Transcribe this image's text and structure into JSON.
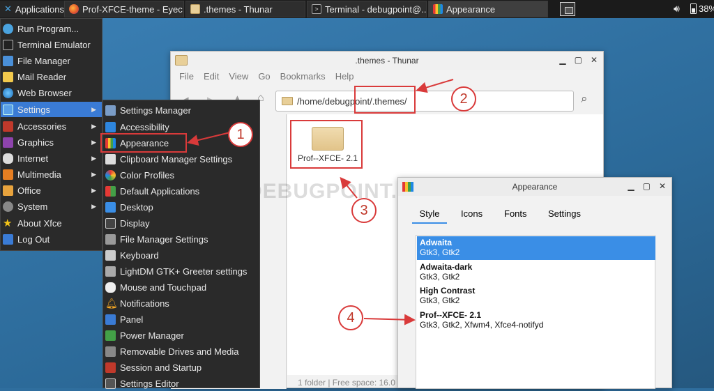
{
  "panel": {
    "applications_label": "Applications",
    "tasks": [
      {
        "label": "Prof-XFCE-theme - Eyec...",
        "icon": "firefox-icon"
      },
      {
        "label": ".themes - Thunar",
        "icon": "folder-icon"
      },
      {
        "label": "Terminal - debugpoint@...",
        "icon": "terminal-icon"
      },
      {
        "label": "Appearance",
        "icon": "appearance-icon"
      }
    ],
    "battery_text": "38%"
  },
  "app_menu": {
    "items": [
      {
        "label": "Run Program..."
      },
      {
        "label": "Terminal Emulator"
      },
      {
        "label": "File Manager"
      },
      {
        "label": "Mail Reader"
      },
      {
        "label": "Web Browser"
      },
      {
        "label": "Settings"
      },
      {
        "label": "Accessories"
      },
      {
        "label": "Graphics"
      },
      {
        "label": "Internet"
      },
      {
        "label": "Multimedia"
      },
      {
        "label": "Office"
      },
      {
        "label": "System"
      },
      {
        "label": "About Xfce"
      },
      {
        "label": "Log Out"
      }
    ]
  },
  "settings_menu": {
    "items": [
      {
        "label": "Settings Manager"
      },
      {
        "label": "Accessibility"
      },
      {
        "label": "Appearance"
      },
      {
        "label": "Clipboard Manager Settings"
      },
      {
        "label": "Color Profiles"
      },
      {
        "label": "Default Applications"
      },
      {
        "label": "Desktop"
      },
      {
        "label": "Display"
      },
      {
        "label": "File Manager Settings"
      },
      {
        "label": "Keyboard"
      },
      {
        "label": "LightDM GTK+ Greeter settings"
      },
      {
        "label": "Mouse and Touchpad"
      },
      {
        "label": "Notifications"
      },
      {
        "label": "Panel"
      },
      {
        "label": "Power Manager"
      },
      {
        "label": "Removable Drives and Media"
      },
      {
        "label": "Session and Startup"
      },
      {
        "label": "Settings Editor"
      }
    ]
  },
  "thunar": {
    "title": ".themes - Thunar",
    "menubar": [
      "File",
      "Edit",
      "View",
      "Go",
      "Bookmarks",
      "Help"
    ],
    "path": "/home/debugpoint/.themes/",
    "folder_name": "Prof--XFCE- 2.1",
    "status": "1 folder | Free space: 16.0"
  },
  "appearance": {
    "title": "Appearance",
    "tabs": [
      "Style",
      "Icons",
      "Fonts",
      "Settings"
    ],
    "themes": [
      {
        "name": "Adwaita",
        "desc": "Gtk3, Gtk2"
      },
      {
        "name": "Adwaita-dark",
        "desc": "Gtk3, Gtk2"
      },
      {
        "name": "High Contrast",
        "desc": "Gtk3, Gtk2"
      },
      {
        "name": "Prof--XFCE- 2.1",
        "desc": "Gtk3, Gtk2, Xfwm4, Xfce4-notifyd"
      }
    ]
  },
  "watermark": "DEBUGPOINT.COM",
  "annotations": [
    "1",
    "2",
    "3",
    "4"
  ],
  "colors": {
    "selection": "#3a8ee6",
    "annotation": "#d93a3a",
    "menu_bg": "#2a2a2a"
  }
}
